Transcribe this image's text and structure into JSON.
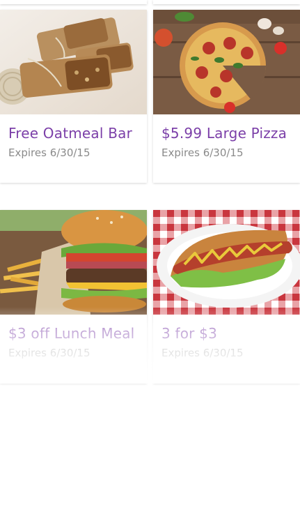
{
  "offers": [
    {
      "title": "Free Oatmeal Bar",
      "expires": "Expires 6/30/15",
      "image": "oatmeal-bar-photo"
    },
    {
      "title": "$5.99 Large Pizza",
      "expires": "Expires 6/30/15",
      "image": "pizza-photo"
    },
    {
      "title": "$3 off Lunch Meal",
      "expires": "Expires 6/30/15",
      "image": "burger-fries-photo"
    },
    {
      "title": "3 for $3",
      "expires": "Expires 6/30/15",
      "image": "hot-dog-photo"
    }
  ],
  "colors": {
    "title": "#7b3fa8",
    "expires": "#8a8a8a",
    "background": "#ffffff"
  }
}
